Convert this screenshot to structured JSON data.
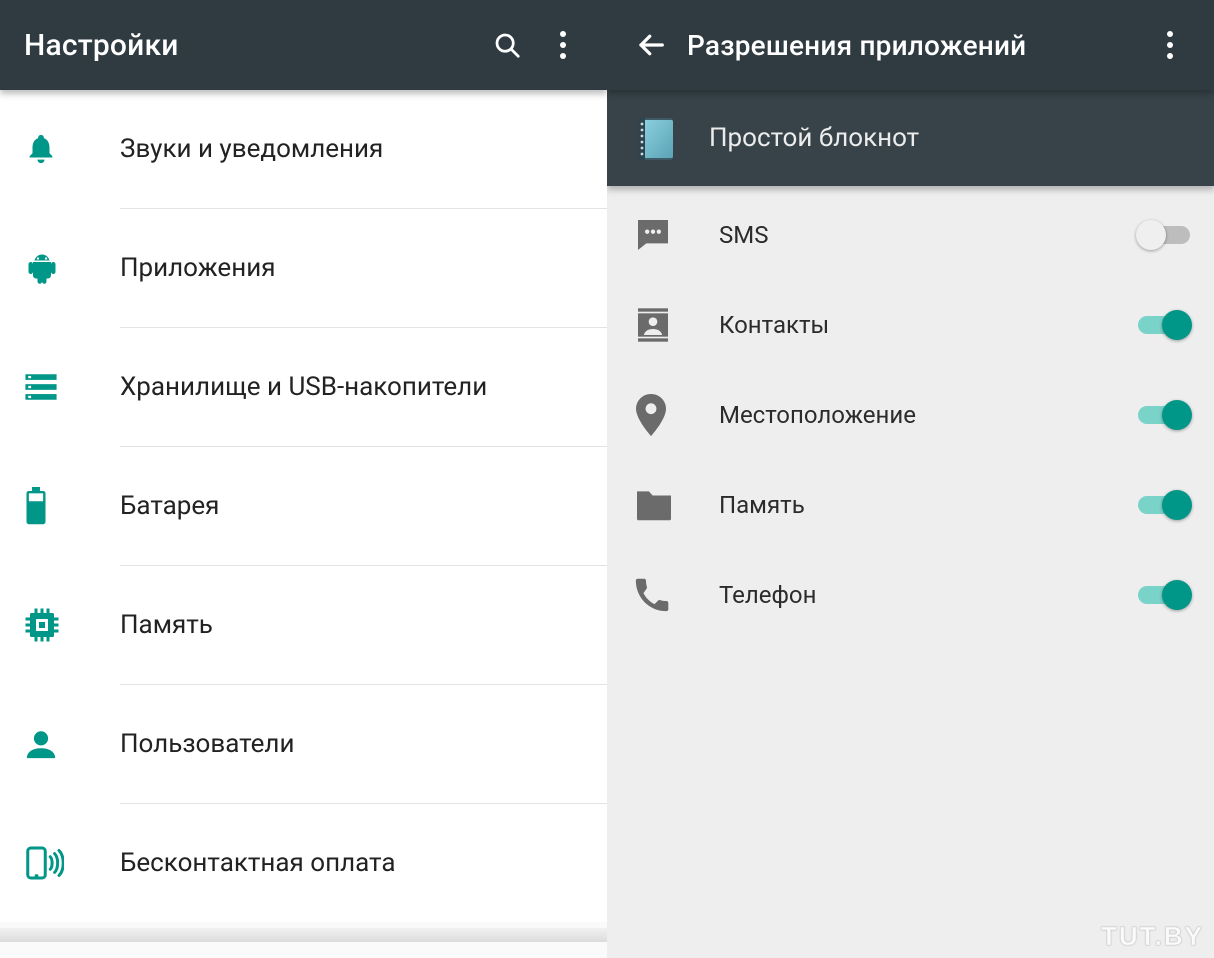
{
  "colors": {
    "accent": "#009688",
    "appbar": "#2f3b40",
    "subheader": "#374349",
    "iconGray": "#6b6b6b"
  },
  "left": {
    "title": "Настройки",
    "items": [
      {
        "icon": "bell-icon",
        "label": "Звуки и уведомления"
      },
      {
        "icon": "android-icon",
        "label": "Приложения"
      },
      {
        "icon": "storage-icon",
        "label": "Хранилище и USB-накопители"
      },
      {
        "icon": "battery-icon",
        "label": "Батарея"
      },
      {
        "icon": "memory-icon",
        "label": "Память"
      },
      {
        "icon": "user-icon",
        "label": "Пользователи"
      },
      {
        "icon": "nfc-icon",
        "label": "Бесконтактная оплата"
      }
    ]
  },
  "right": {
    "title": "Разрешения приложений",
    "app_name": "Простой блокнот",
    "permissions": [
      {
        "icon": "sms-icon",
        "label": "SMS",
        "on": false
      },
      {
        "icon": "contacts-icon",
        "label": "Контакты",
        "on": true
      },
      {
        "icon": "location-icon",
        "label": "Местоположение",
        "on": true
      },
      {
        "icon": "folder-icon",
        "label": "Память",
        "on": true
      },
      {
        "icon": "phone-icon",
        "label": "Телефон",
        "on": true
      }
    ]
  },
  "watermark": "TUT.BY"
}
